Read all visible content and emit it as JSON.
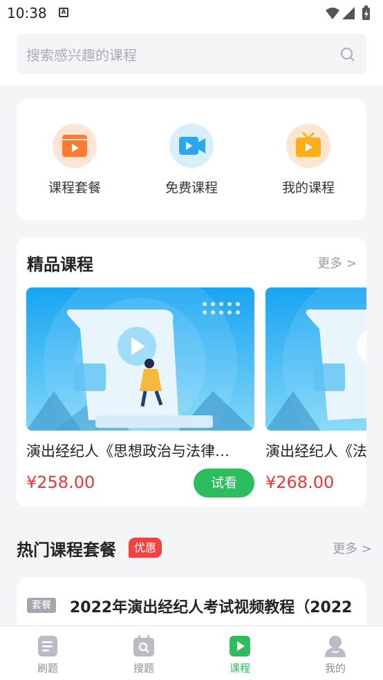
{
  "status_bar": {
    "time": "10:38",
    "notification_icon": "A"
  },
  "search": {
    "placeholder": "搜索感兴趣的课程"
  },
  "entries": [
    {
      "label": "课程套餐",
      "icon": "play-card-orange-icon",
      "color": "#ff7a2f"
    },
    {
      "label": "免费课程",
      "icon": "video-camera-blue-icon",
      "color": "#2aa5ee"
    },
    {
      "label": "我的课程",
      "icon": "tv-yellow-icon",
      "color": "#ffae17"
    }
  ],
  "featured": {
    "title": "精品课程",
    "more": "更多 >",
    "courses": [
      {
        "title": "演出经纪人《思想政治与法律…",
        "price": "¥258.00",
        "trial": "试看"
      },
      {
        "title": "演出经纪人《法律",
        "price": "¥268.00"
      }
    ]
  },
  "hot_packages": {
    "title": "热门课程套餐",
    "badge": "优惠",
    "more": "更多 >",
    "items": [
      {
        "tag": "套餐",
        "title": "2022年演出经纪人考试视频教程（2022"
      }
    ]
  },
  "tabs": [
    {
      "label": "刷题",
      "icon": "document-icon",
      "active": false
    },
    {
      "label": "搜题",
      "icon": "calendar-search-icon",
      "active": false
    },
    {
      "label": "课程",
      "icon": "play-square-icon",
      "active": true
    },
    {
      "label": "我的",
      "icon": "person-icon",
      "active": false
    }
  ],
  "colors": {
    "accent": "#2dbd5e",
    "price": "#e8353b",
    "badge": "#f0433f"
  }
}
